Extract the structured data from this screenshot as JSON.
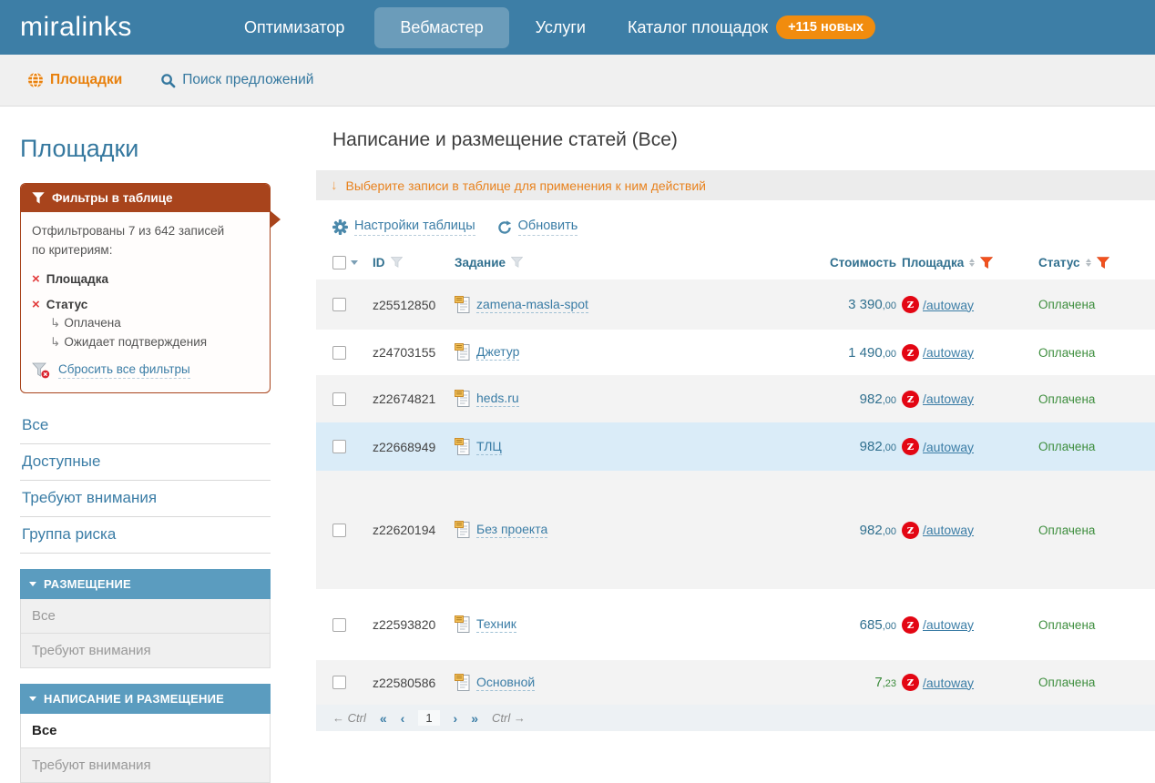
{
  "colors": {
    "topnav_bg": "#3d7ea6",
    "active_tab_bg": "#6b9cba",
    "badge_bg": "#f18c0e",
    "accent_orange": "#e8800c",
    "link_blue": "#3b7da6",
    "steel_header": "#31708f",
    "filter_panel_brick": "#a8441c",
    "section_header_blue": "#5b9cbf",
    "status_green": "#3e8e3e",
    "selected_row": "#daecf8",
    "site_icon_red": "#e30613"
  },
  "icons": {
    "down_arrow": "↓",
    "cross": "×",
    "sub_arrow": "↳"
  },
  "top_nav": {
    "logo": "miralinks",
    "items": [
      {
        "label": "Оптимизатор"
      },
      {
        "label": "Вебмастер",
        "active": true
      },
      {
        "label": "Услуги"
      },
      {
        "label": "Каталог площадок"
      }
    ],
    "badge": "+115 новых"
  },
  "subnav": {
    "sites": "Площадки",
    "search": "Поиск предложений"
  },
  "sidebar": {
    "title": "Площадки",
    "filter_panel": {
      "header": "Фильтры в таблице",
      "summary_line1": "Отфильтрованы 7 из 642 записей",
      "summary_line2": "по критериям:",
      "criteria": [
        {
          "label": "Площадка",
          "children": []
        },
        {
          "label": "Статус",
          "children": [
            "Оплачена",
            "Ожидает подтверждения"
          ]
        }
      ],
      "clear_label": "Сбросить все фильтры"
    },
    "links": [
      {
        "label": "Все"
      },
      {
        "label": "Доступные"
      },
      {
        "label": "Требуют внимания"
      },
      {
        "label": "Группа риска"
      }
    ],
    "sections": [
      {
        "title": "РАЗМЕЩЕНИЕ",
        "items": [
          {
            "label": "Все"
          },
          {
            "label": "Требуют внимания"
          }
        ]
      },
      {
        "title": "НАПИСАНИЕ И РАЗМЕЩЕНИЕ",
        "items": [
          {
            "label": "Все",
            "active": true
          },
          {
            "label": "Требуют внимания"
          }
        ]
      }
    ]
  },
  "main": {
    "title": "Написание и размещение статей (Все)",
    "banner_text": "Выберите записи в таблице для применения к ним действий",
    "toolbar": {
      "settings": "Настройки таблицы",
      "refresh": "Обновить"
    }
  },
  "table": {
    "columns": {
      "id": "ID",
      "task": "Задание",
      "price": "Стоимость",
      "site": "Площадка",
      "status": "Статус"
    },
    "site_icon_letter": "z",
    "rows": [
      {
        "id": "z25512850",
        "task": "zamena-masla-spot",
        "price_int": "3 390",
        "price_dec": ",00",
        "site": "/autoway",
        "status": "Оплачена"
      },
      {
        "id": "z24703155",
        "task": "Джетур",
        "price_int": "1 490",
        "price_dec": ",00",
        "site": "/autoway",
        "status": "Оплачена"
      },
      {
        "id": "z22674821",
        "task": "heds.ru",
        "price_int": "982",
        "price_dec": ",00",
        "site": "/autoway",
        "status": "Оплачена"
      },
      {
        "id": "z22668949",
        "task": "ТЛЦ",
        "price_int": "982",
        "price_dec": ",00",
        "site": "/autoway",
        "status": "Оплачена"
      },
      {
        "id": "z22620194",
        "task": "Без проекта",
        "price_int": "982",
        "price_dec": ",00",
        "site": "/autoway",
        "status": "Оплачена"
      },
      {
        "id": "z22593820",
        "task": "Техник",
        "price_int": "685",
        "price_dec": ",00",
        "site": "/autoway",
        "status": "Оплачена"
      },
      {
        "id": "z22580586",
        "task": "Основной",
        "price_int": "7",
        "price_dec": ",23",
        "site": "/autoway",
        "status": "Оплачена"
      }
    ]
  },
  "pagination": {
    "ctrl_left": "← Ctrl",
    "first": "«",
    "prev": "‹",
    "page": "1",
    "next": "›",
    "last": "»",
    "ctrl_right": "Ctrl →"
  }
}
